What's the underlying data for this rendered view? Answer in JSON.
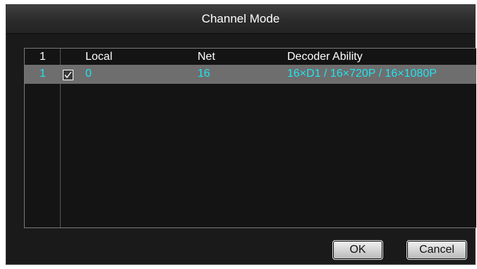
{
  "dialog": {
    "title": "Channel Mode"
  },
  "table": {
    "headers": {
      "index": "1",
      "local": "Local",
      "net": "Net",
      "decoder": "Decoder Ability"
    },
    "rows": [
      {
        "index": "1",
        "checked": true,
        "local": "0",
        "net": "16",
        "decoder": "16×D1 / 16×720P / 16×1080P"
      }
    ]
  },
  "buttons": {
    "ok": "OK",
    "cancel": "Cancel"
  },
  "colors": {
    "selected_row_bg": "#6e6e6e",
    "selected_row_text": "#22e4f0",
    "dialog_bg": "#1a1a1a"
  }
}
